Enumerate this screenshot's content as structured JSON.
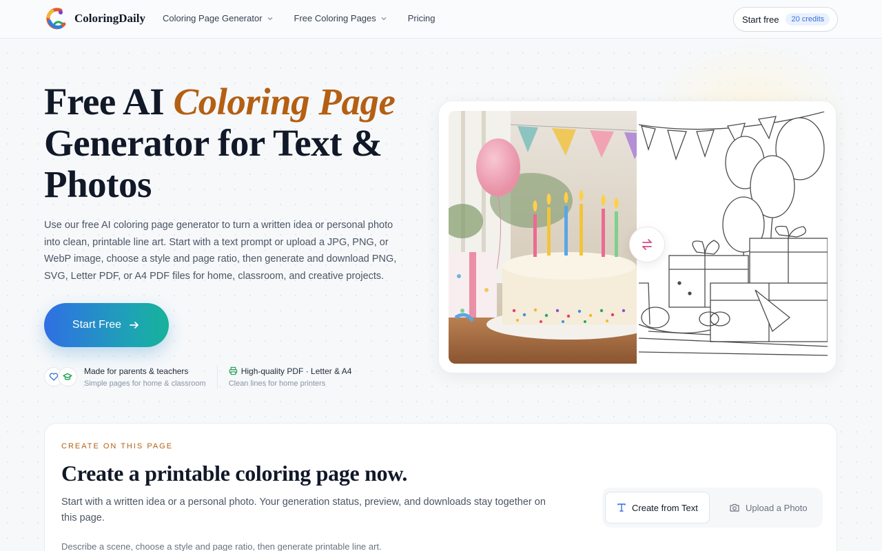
{
  "brand": {
    "name": "ColoringDaily"
  },
  "nav": {
    "items": [
      {
        "label": "Coloring Page Generator",
        "has_dropdown": true
      },
      {
        "label": "Free Coloring Pages",
        "has_dropdown": true
      },
      {
        "label": "Pricing",
        "has_dropdown": false
      }
    ],
    "start_label": "Start free",
    "credits_label": "20 credits"
  },
  "hero": {
    "title_part1": "Free AI ",
    "title_accent": "Coloring Page",
    "title_part2": "Generator for Text & Photos",
    "description": "Use our free AI coloring page generator to turn a written idea or personal photo into clean, printable line art. Start with a text prompt or upload a JPG, PNG, or WebP image, choose a style and page ratio, then generate and download PNG, SVG, Letter PDF, or A4 PDF files for home, classroom, and creative projects.",
    "cta_label": "Start Free",
    "trust": [
      {
        "title": "Made for parents & teachers",
        "subtitle": "Simple pages for home & classroom"
      },
      {
        "title": "High-quality PDF · Letter & A4",
        "subtitle": "Clean lines for home printers"
      }
    ]
  },
  "create": {
    "eyebrow": "CREATE ON THIS PAGE",
    "title": "Create a printable coloring page now.",
    "description": "Start with a written idea or a personal photo. Your generation status, preview, and downloads stay together on this page.",
    "hint": "Describe a scene, choose a style and page ratio, then generate printable line art.",
    "tabs": [
      {
        "label": "Create from Text",
        "active": true
      },
      {
        "label": "Upload a Photo",
        "active": false
      }
    ]
  },
  "colors": {
    "accent_orange": "#b45f13",
    "cta_start": "#2f6fe4",
    "cta_end": "#16b29a",
    "credits_blue": "#3b6fd8",
    "swap_pink": "#d64a8a"
  }
}
